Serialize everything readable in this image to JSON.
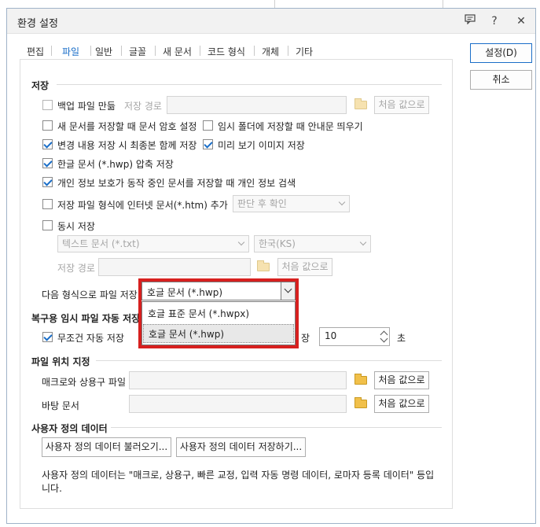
{
  "window": {
    "title": "환경 설정"
  },
  "titlebar": {
    "help": "?",
    "close": "✕"
  },
  "tabs": [
    {
      "label": "편집"
    },
    {
      "label": "파일"
    },
    {
      "label": "일반"
    },
    {
      "label": "글꼴"
    },
    {
      "label": "새 문서"
    },
    {
      "label": "코드 형식"
    },
    {
      "label": "개체"
    },
    {
      "label": "기타"
    }
  ],
  "buttons": {
    "ok": "설정(D)",
    "cancel": "취소"
  },
  "save": {
    "heading": "저장",
    "backup": {
      "label": "백업 파일 만듦",
      "path_label": "저장 경로",
      "reset": "처음 값으로"
    },
    "password": {
      "label": "새 문서를 저장할 때 문서 암호 설정"
    },
    "temp_notice": {
      "label": "임시 폴더에 저장할 때 안내문 띄우기"
    },
    "latest": {
      "label": "변경 내용 저장 시 최종본 함께 저장"
    },
    "preview": {
      "label": "미리 보기 이미지 저장"
    },
    "compress": {
      "label": "한글 문서 (*.hwp) 압축 저장"
    },
    "privacy": {
      "label": "개인 정보 보호가 동작 중인 문서를 저장할 때 개인 정보 검색"
    },
    "internet": {
      "label": "저장 파일 형식에 인터넷 문서(*.htm) 추가",
      "select": "판단 후 확인"
    },
    "simul": {
      "label": "동시 저장",
      "format": "텍스트 문서 (*.txt)",
      "encoding": "한국(KS)",
      "path_label": "저장 경로",
      "reset": "처음 값으로"
    },
    "next_format": {
      "label": "다음 형식으로 파일 저장",
      "value": "호글 문서 (*.hwp)",
      "options": [
        "호글 표준 문서 (*.hwpx)",
        "호글 문서 (*.hwp)"
      ]
    }
  },
  "recovery": {
    "heading": "복구용 임시 파일 자동 저장",
    "always": {
      "label": "무조건 자동 저장"
    },
    "idle_suffix": "장",
    "idle_value": "10",
    "unit": "초"
  },
  "location": {
    "heading": "파일 위치 지정",
    "macro": {
      "label": "매크로와 상용구 파일",
      "reset": "처음 값으로"
    },
    "background": {
      "label": "바탕 문서",
      "reset": "처음 값으로"
    }
  },
  "userdata": {
    "heading": "사용자 정의 데이터",
    "load": "사용자 정의 데이터 불러오기...",
    "save": "사용자 정의 데이터 저장하기...",
    "note": "사용자 정의 데이터는 \"매크로, 상용구, 빠른 교정, 입력 자동 명령 데이터, 로마자 등록 데이터\" 등입니다."
  }
}
